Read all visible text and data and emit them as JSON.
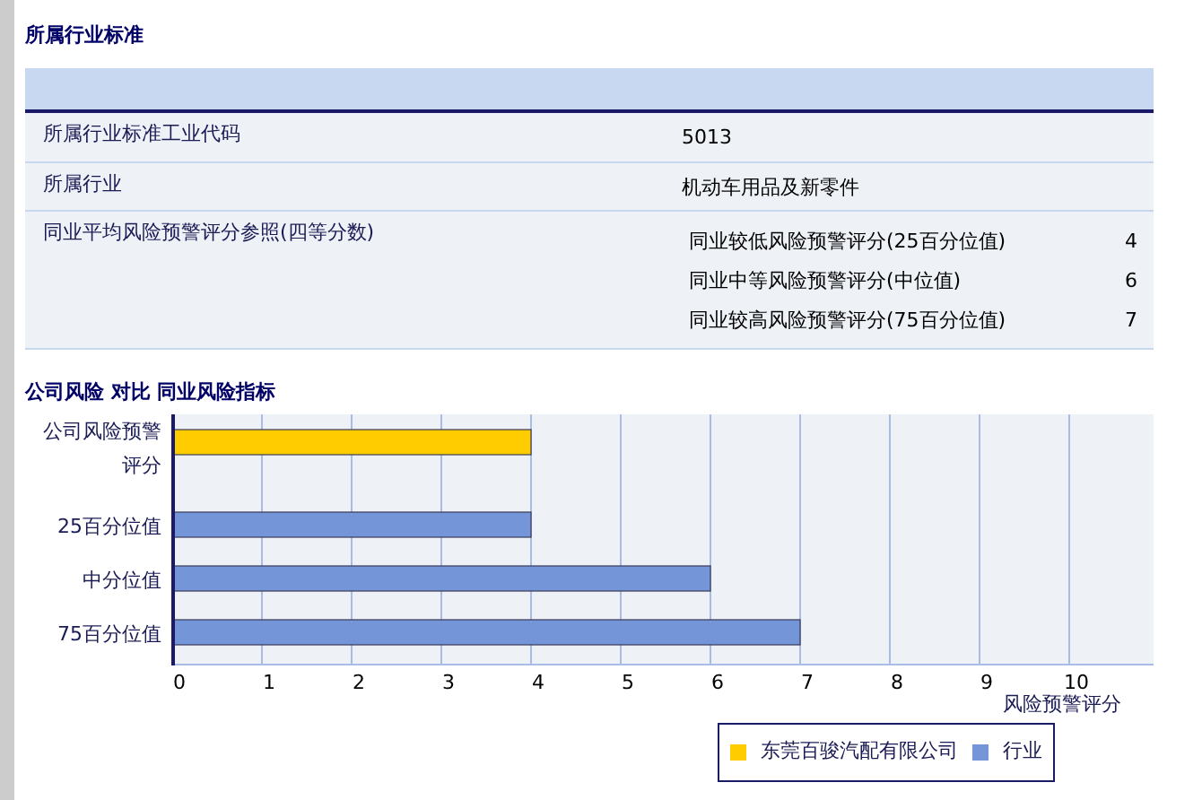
{
  "section_1": {
    "title": "所属行业标准",
    "rows": [
      {
        "label": "所属行业标准工业代码",
        "value": "5013"
      },
      {
        "label": "所属行业",
        "value": "机动车用品及新零件"
      },
      {
        "label": "同业平均风险预警评分参照(四等分数)",
        "items": [
          {
            "label": "同业较低风险预警评分(25百分位值)",
            "value": "4"
          },
          {
            "label": "同业中等风险预警评分(中位值)",
            "value": "6"
          },
          {
            "label": "同业较高风险预警评分(75百分位值)",
            "value": "7"
          }
        ]
      }
    ]
  },
  "section_2": {
    "title": "公司风险 对比 同业风险指标",
    "chart_data": {
      "type": "bar",
      "orientation": "horizontal",
      "grid": true,
      "legend": "bottom-right",
      "xlabel": "风险预警评分",
      "categories": [
        "公司风险预警评分",
        "25百分位值",
        "中分位值",
        "75百分位值"
      ],
      "series": [
        {
          "name": "东莞百骏汽配有限公司",
          "color": "#ffcc00",
          "values": [
            4,
            null,
            null,
            null
          ]
        },
        {
          "name": "行业",
          "color": "#7595d9",
          "values": [
            null,
            4,
            6,
            7
          ]
        }
      ],
      "xlim": [
        0,
        10.94
      ],
      "xticks": [
        0,
        1,
        2,
        3,
        4,
        5,
        6,
        7,
        8,
        9,
        10
      ]
    }
  }
}
